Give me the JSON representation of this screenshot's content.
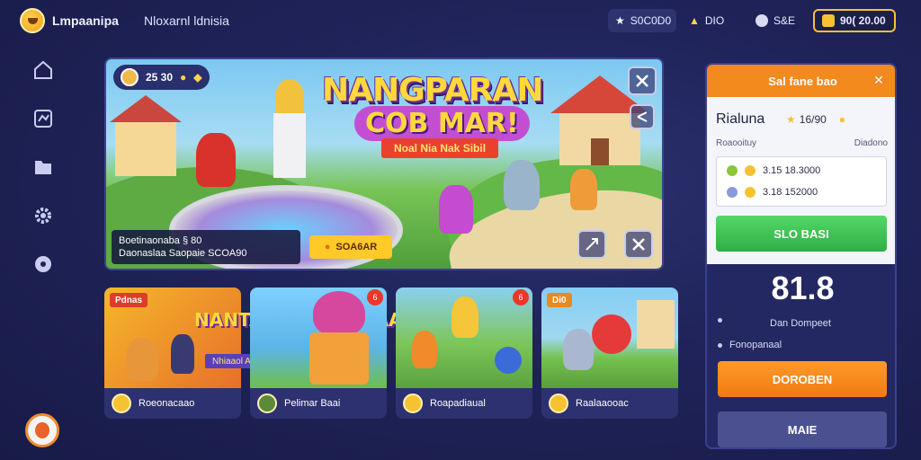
{
  "topbar": {
    "app_name": "Lmpaanipa",
    "nav_title": "Nloxarnl ldnisia",
    "pill_1": "S0C0D0",
    "pill_2": "DIO",
    "pill_3": "S&E",
    "coins": "90( 20.00"
  },
  "banner": {
    "stats_value": "25 30",
    "title": "NANGPARAN",
    "subtitle": "COB MAR!",
    "ribbon": "Noal Nia Nak Sibil",
    "info_line1": "Boetinaonaba § 80",
    "info_line2": "Daonaslaa Saopaie SCOA90",
    "cta_label": "SOA6AR"
  },
  "cards": [
    {
      "tag": "Pdnas",
      "title": "NANTAAAN DINBVAAI",
      "ribbon": "Nhiaaol ALI Sas!",
      "label": "Roeonacaao",
      "badge": ""
    },
    {
      "tag": "",
      "title": "",
      "label": "Pelimar Baai",
      "badge": "6"
    },
    {
      "tag": "",
      "title": "",
      "label": "Roapadiaual",
      "badge": "6"
    },
    {
      "tag": "Di0",
      "title": "",
      "label": "Raalaaooac",
      "badge": ""
    }
  ],
  "panel": {
    "header": "Sal fane bao",
    "player_name": "Rialuna",
    "score": "16/90",
    "label_left": "Roaooituy",
    "label_right": "Diadono",
    "row1": "3.15 18.3000",
    "row2": "3.18 152000",
    "green_button": "SLO BASI",
    "big_number": "81.8",
    "detail1": "Dan Dompeet",
    "detail2": "Fonopanaal",
    "orange_button": "DOROBEN",
    "gray_button": "MAIE"
  },
  "colors": {
    "background": "#1f2359",
    "accent_orange": "#f28a1e",
    "accent_green": "#2fae45",
    "gold": "#f6c232"
  }
}
